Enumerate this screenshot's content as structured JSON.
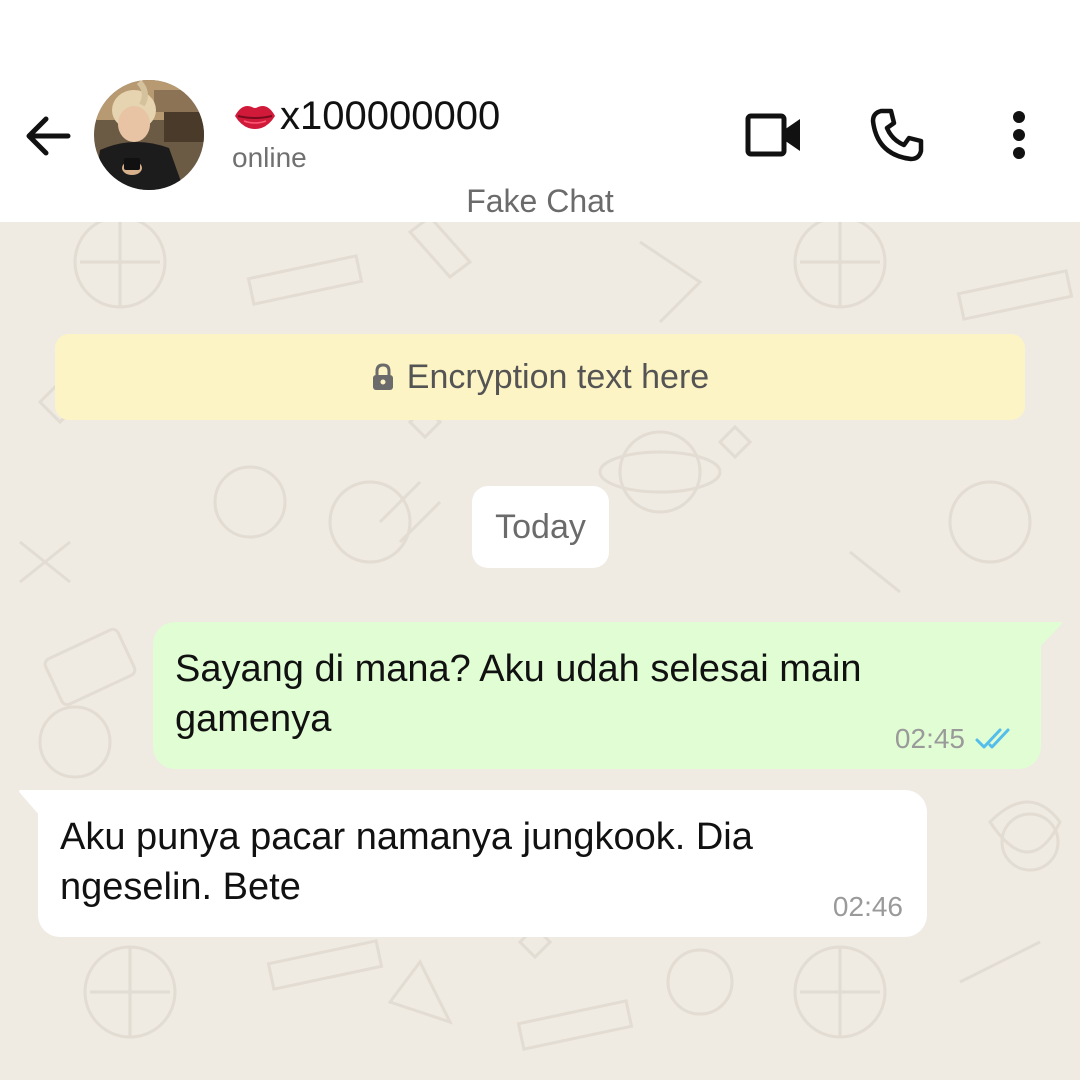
{
  "header": {
    "contact_name": "x100000000",
    "status": "online",
    "subtitle": "Fake Chat",
    "icons": {
      "back": "arrow-left-icon",
      "video": "video-call-icon",
      "call": "phone-icon",
      "menu": "more-vertical-icon",
      "name_emoji": "kiss-lips-icon"
    }
  },
  "chat": {
    "encryption_text": "Encryption text here",
    "date_label": "Today",
    "messages": [
      {
        "direction": "outgoing",
        "text": "Sayang di mana? Aku udah selesai main gamenya",
        "time": "02:45",
        "status": "read"
      },
      {
        "direction": "incoming",
        "text": "Aku punya pacar namanya jungkook. Dia ngeselin. Bete",
        "time": "02:46"
      }
    ]
  },
  "colors": {
    "chat_background": "#efeae2",
    "outgoing_bubble": "#e1fdd4",
    "incoming_bubble": "#ffffff",
    "encryption_banner": "#fdf4c5",
    "read_ticks": "#53bdeb"
  }
}
